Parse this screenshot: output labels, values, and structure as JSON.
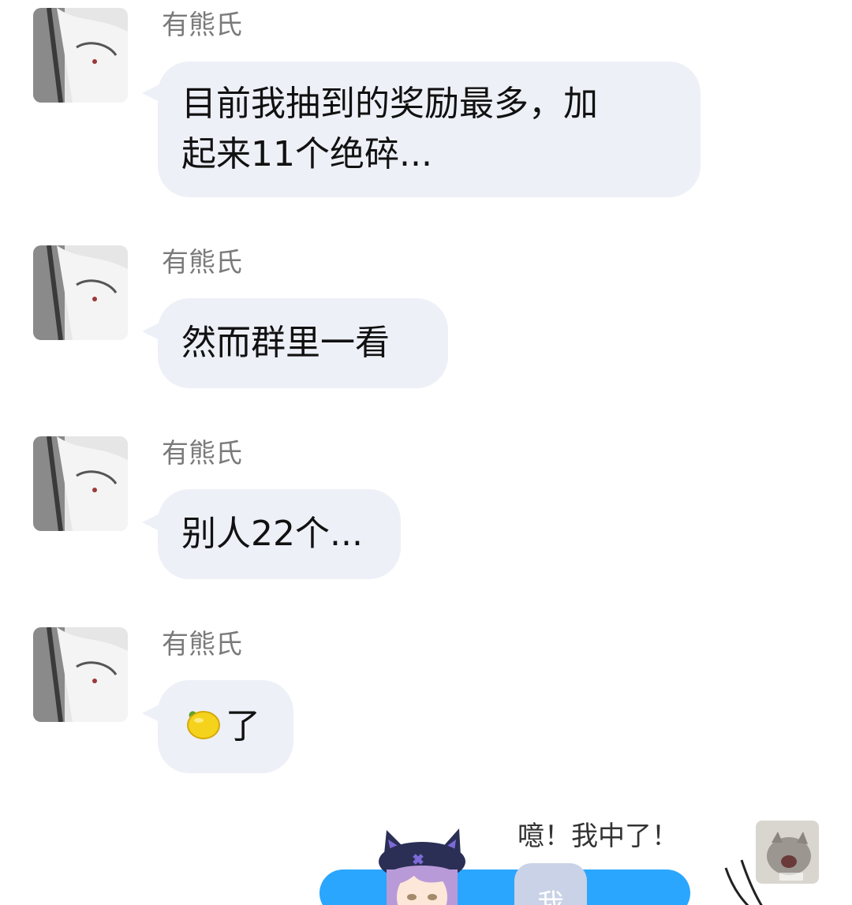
{
  "messages": [
    {
      "sender": "有熊氏",
      "text_lines": [
        "目前我抽到的奖励最多，加",
        "起来11个绝碎..."
      ]
    },
    {
      "sender": "有熊氏",
      "text_lines": [
        "然而群里一看"
      ]
    },
    {
      "sender": "有熊氏",
      "text_lines": [
        "别人22个..."
      ]
    },
    {
      "sender": "有熊氏",
      "text_lines": [
        "了"
      ],
      "emoji": "lemon-icon"
    }
  ],
  "self": {
    "text": "噫！我中了！",
    "me_label": "我"
  },
  "colors": {
    "bubble_bg": "#eef0f8",
    "sender_gray": "#7a7a7a",
    "accent_blue": "#2aa6ff"
  }
}
